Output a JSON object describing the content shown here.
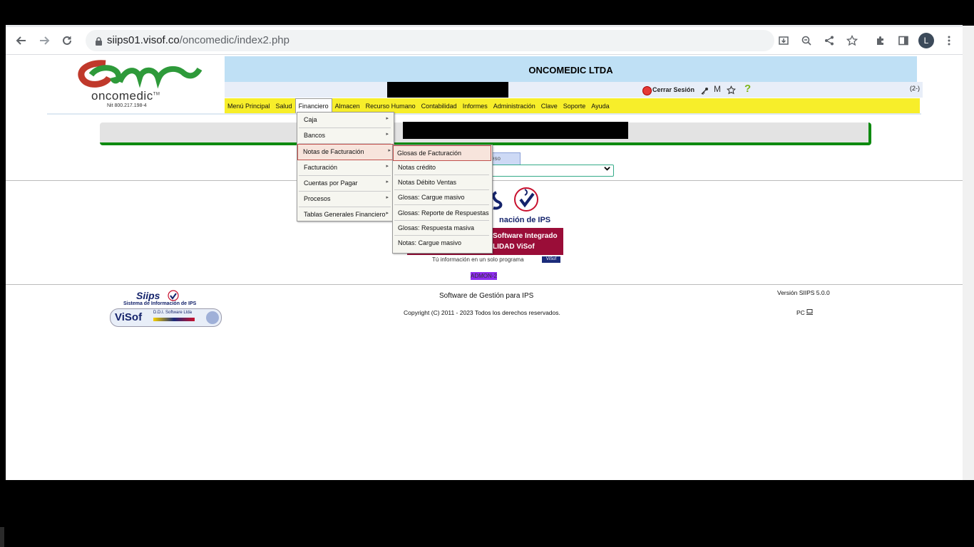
{
  "browser": {
    "url_host": "siips01.visof.co",
    "url_path": "/oncomedic/index2.php",
    "avatar_letter": "L"
  },
  "header": {
    "logo_text": "oncomedic",
    "logo_tm": "TM",
    "logo_nit": "Nit 800.217.198-4",
    "company_name": "ONCOMEDIC LTDA",
    "logout_label": "Cerrar Sesión",
    "m_label": "M",
    "help_label": "?",
    "session_tag": "(2-)"
  },
  "menu": {
    "items": [
      "Menú Principal",
      "Salud",
      "Financiero",
      "Almacen",
      "Recurso Humano",
      "Contabilidad",
      "Informes",
      "Administración",
      "Clave",
      "Soporte",
      "Ayuda"
    ],
    "active": "Financiero"
  },
  "financiero_menu": {
    "items": [
      "Caja",
      "Bancos",
      "Notas de Facturación",
      "Facturación",
      "Cuentas por Pagar",
      "Procesos",
      "Tablas Generales Financiero"
    ],
    "highlighted": "Notas de Facturación"
  },
  "notas_submenu": {
    "items": [
      "Glosas de Facturación",
      "Notas crédito",
      "Notas Débito Ventas",
      "Glosas: Cargue masivo",
      "Glosas: Reporte de Respuestas",
      "Glosas: Respuesta masiva",
      "Notas: Cargue masivo"
    ],
    "highlighted": "Glosas de Facturación"
  },
  "content": {
    "proceso_button": "ceso",
    "siips_subtitle": "nación de IPS",
    "banner_line1": "Software Integrado",
    "banner_line2": "LIDAD ViSof",
    "tagline": "Tú información en un solo programa",
    "visof_badge": "ViSof",
    "admon_tag": "ADMON-2"
  },
  "footer": {
    "siips_logo_title": "Siips",
    "siips_logo_sub": "Sistema de Información de IPS",
    "visof_logo": "ViSof",
    "visof_logo_sub": "D.D.I. Software Ltda",
    "center_title": "Software de Gestión para IPS",
    "copyright": "Copyright (C) 2011 - 2023 Todos los derechos reservados.",
    "version": "Versión SIIPS 5.0.0",
    "pc_label": "PC"
  },
  "colors": {
    "menubar": "#f7ee2a",
    "company_bar": "#bfe0f5",
    "panel_accent": "#0e8a10",
    "banner": "#9a0d38",
    "admon": "#8e2cf0"
  }
}
